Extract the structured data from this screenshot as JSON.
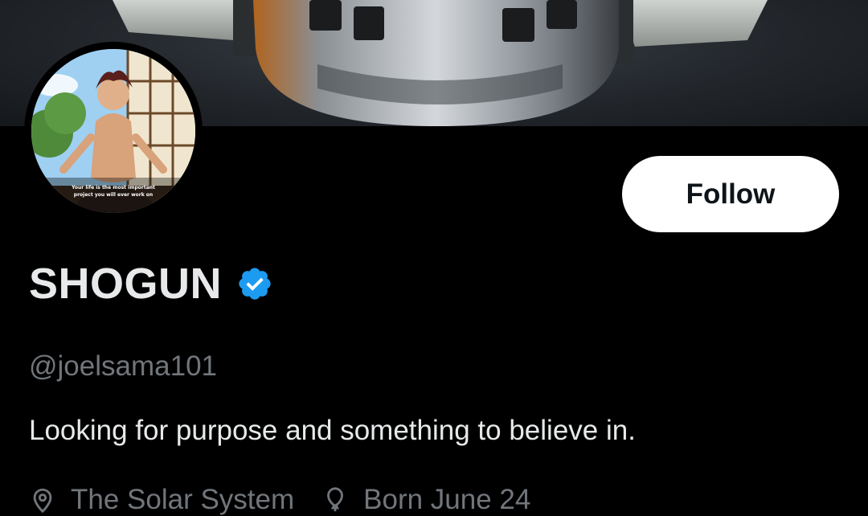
{
  "profile": {
    "display_name": "SHOGUN",
    "handle": "@joelsama101",
    "bio": "Looking for purpose and something to believe in.",
    "location": "The Solar System",
    "birthday": "Born June 24",
    "verified": true,
    "avatar_caption_line1": "Your life is the most important",
    "avatar_caption_line2": "project you will ever work on"
  },
  "actions": {
    "follow_label": "Follow"
  },
  "icons": {
    "verified": "verified-badge-icon",
    "location": "location-pin-icon",
    "birthday": "balloon-icon"
  },
  "colors": {
    "verified_blue": "#1d9bf0",
    "background": "#000000"
  }
}
